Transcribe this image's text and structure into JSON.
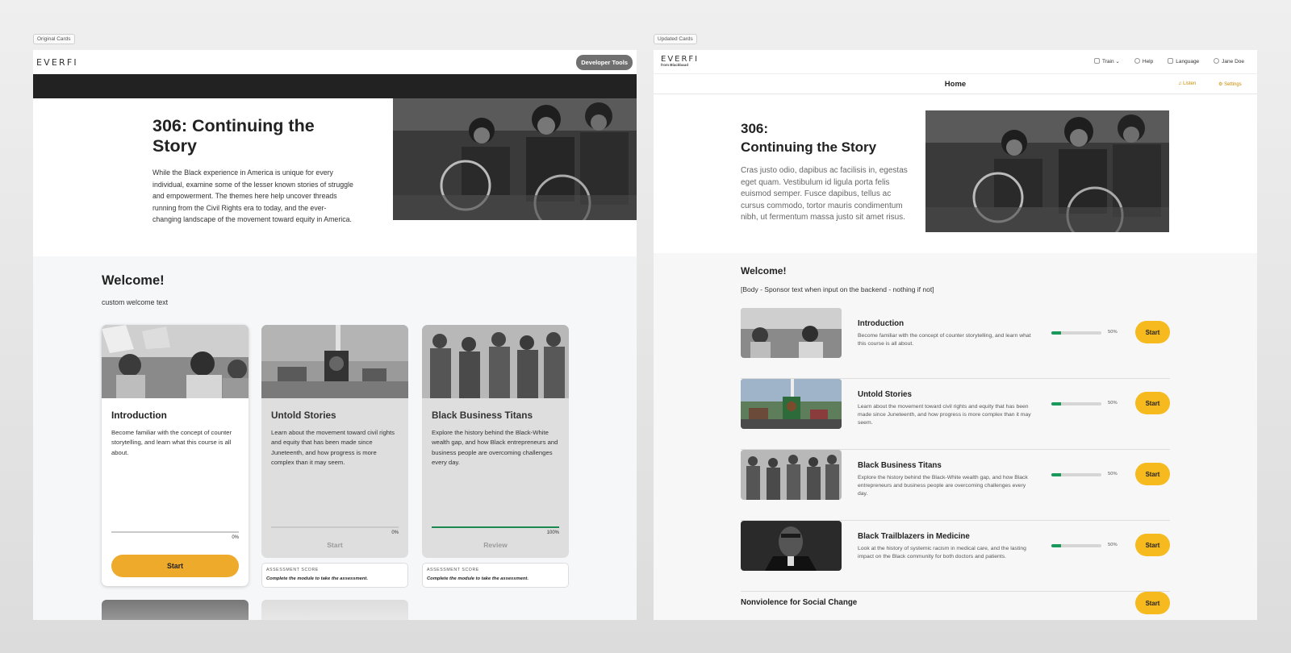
{
  "labels": {
    "original": "Original Cards",
    "updated": "Updated Cards"
  },
  "left": {
    "logo": "EVERFI",
    "dev_tools": "Developer Tools",
    "course_title": "306: Continuing the Story",
    "course_desc": "While the Black experience in America is unique for every individual, examine some of the lesser known stories of struggle and empowerment. The themes here help uncover threads running from the Civil Rights era to today, and the ever-changing landscape of the movement toward equity in America.",
    "welcome_title": "Welcome!",
    "welcome_text": "custom welcome text",
    "cards": [
      {
        "title": "Introduction",
        "desc": "Become familiar with the concept of counter storytelling, and learn what this course is all about.",
        "progress_text": "0%",
        "progress": 0,
        "action": "Start"
      },
      {
        "title": "Untold Stories",
        "desc": "Learn about the movement toward civil rights and equity that has been made since Juneteenth, and how progress is more complex than it may seem.",
        "progress_text": "0%",
        "progress": 0,
        "action": "Start"
      },
      {
        "title": "Black Business Titans",
        "desc": "Explore the history behind the Black-White wealth gap, and how Black entrepreneurs and business people are overcoming challenges every day.",
        "progress_text": "100%",
        "progress": 100,
        "action": "Review"
      }
    ],
    "assessment_label": "ASSESSMENT SCORE",
    "assessment_note": "Complete the module to take the assessment."
  },
  "right": {
    "logo": "EVERFI",
    "logo_sub": "from Blackbaud",
    "nav": {
      "train": "Train",
      "help": "Help",
      "language": "Language",
      "user": "Jane Doe"
    },
    "page_title": "Home",
    "listen": "Listen",
    "settings": "Settings",
    "course_title_line1": "306:",
    "course_title_line2": "Continuing the Story",
    "course_desc": "Cras justo odio, dapibus ac facilisis in, egestas eget quam. Vestibulum id ligula porta felis euismod semper. Fusce dapibus, tellus ac cursus commodo, tortor mauris condimentum nibh, ut fermentum massa justo sit amet risus.",
    "welcome_title": "Welcome!",
    "welcome_text": "[Body - Sponsor text when input on the backend - nothing if not]",
    "modules": [
      {
        "title": "Introduction",
        "desc": "Become familiar with the concept of counter storytelling, and learn what this course is all about.",
        "progress_text": "50%",
        "progress": 20,
        "action": "Start"
      },
      {
        "title": "Untold Stories",
        "desc": "Learn about the movement toward civil rights and equity that has been made since Juneteenth, and how progress is more complex than it may seem.",
        "progress_text": "50%",
        "progress": 20,
        "action": "Start"
      },
      {
        "title": "Black Business Titans",
        "desc": "Explore the history behind the Black-White wealth gap, and how Black entrepreneurs and business people are overcoming challenges every day.",
        "progress_text": "50%",
        "progress": 20,
        "action": "Start"
      },
      {
        "title": "Black Trailblazers in Medicine",
        "desc": "Look at the history of systemic racism in medical care, and the lasting impact on the Black community for both doctors and patients.",
        "progress_text": "50%",
        "progress": 20,
        "action": "Start"
      }
    ],
    "last_module": {
      "title": "Nonviolence for Social Change",
      "action": "Start"
    }
  },
  "colors": {
    "accent_left": "#eeaa2a",
    "accent_right": "#f6b91e",
    "progress_green": "#1a8a4f"
  }
}
